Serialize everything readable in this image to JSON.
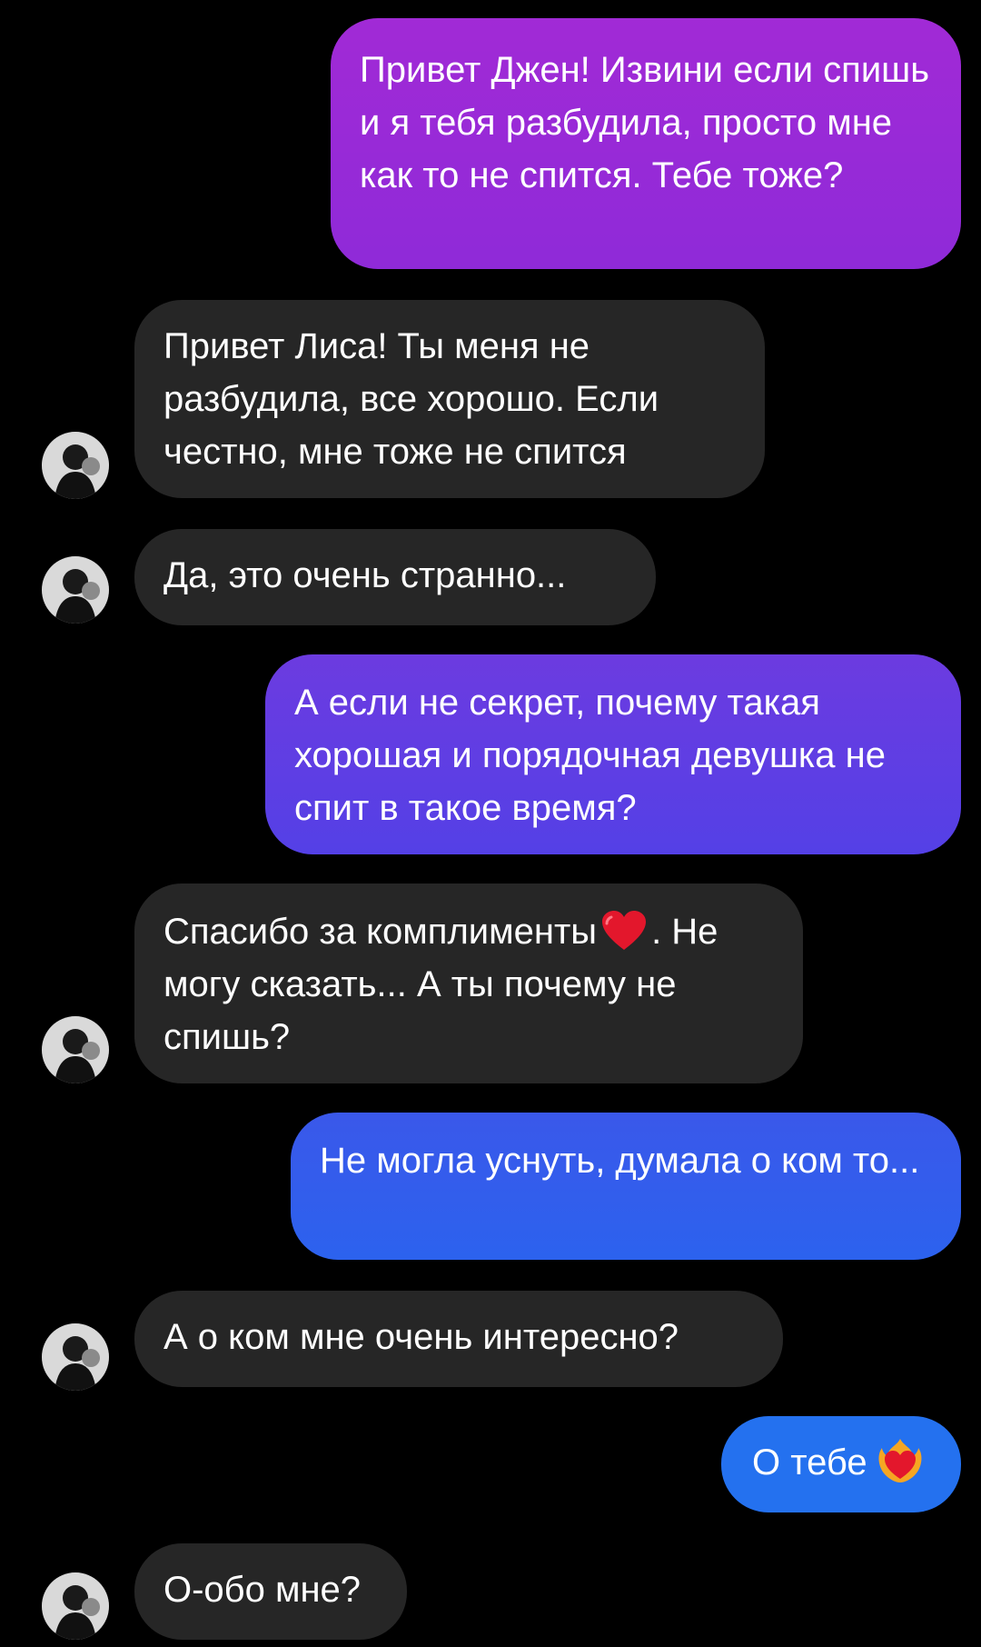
{
  "conversation": {
    "messages": [
      {
        "direction": "outgoing",
        "text": "Привет Джен! Извини если спишь и я тебя разбудила, просто мне как то не спится. Тебе тоже?"
      },
      {
        "direction": "incoming",
        "text": "Привет Лиса! Ты меня не разбудила, все хорошо. Если честно, мне тоже не спится"
      },
      {
        "direction": "incoming",
        "text": "Да, это очень странно..."
      },
      {
        "direction": "outgoing",
        "text": "А если не секрет, почему такая хорошая и порядочная девушка не спит в такое время?"
      },
      {
        "direction": "incoming",
        "text_before_emoji": "Спасибо за комплименты",
        "emoji": "red-heart",
        "text_after_emoji": ". Не могу сказать... А ты почему не спишь?"
      },
      {
        "direction": "outgoing",
        "text": "Не могла уснуть, думала о ком то..."
      },
      {
        "direction": "incoming",
        "text": "А о ком мне очень интересно?"
      },
      {
        "direction": "outgoing",
        "text": "О тебе",
        "emoji": "heart-on-fire"
      },
      {
        "direction": "incoming",
        "text": "О-обо мне?"
      }
    ]
  },
  "colors": {
    "background": "#000000",
    "incoming_bubble": "#262626",
    "outgoing_purple": "#9b27d6",
    "outgoing_indigo": "#5b3ee0",
    "outgoing_blue": "#2d63ee",
    "outgoing_bright_blue": "#1f6ff0",
    "text": "#ffffff"
  }
}
